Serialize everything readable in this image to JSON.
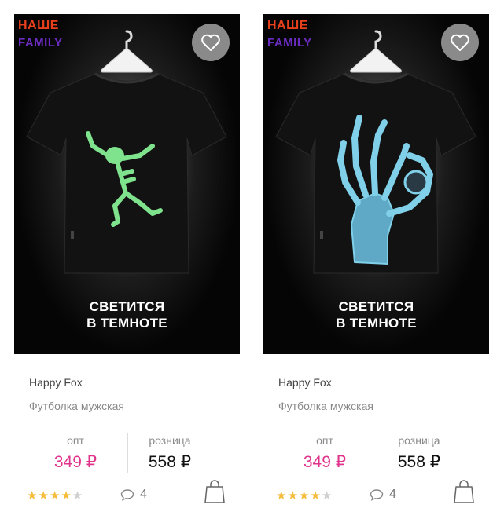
{
  "colors": {
    "tag_top": "#e8401c",
    "tag_bottom": "#6a2cc0",
    "accent_price": "#e0338b",
    "star_on": "#f5bd3b",
    "star_off": "#cfcfcf"
  },
  "products": [
    {
      "tag_line1": "НАШЕ",
      "tag_line2": "FAMILY",
      "caption_line1": "СВЕТИТСЯ",
      "caption_line2": "В ТЕМНОТЕ",
      "brand": "Happy Fox",
      "type": "Футболка мужская",
      "opt_label": "опт",
      "opt_price": "349 ₽",
      "retail_label": "розница",
      "retail_price": "558 ₽",
      "rating": 4,
      "rating_max": 5,
      "reviews": "4",
      "print": "skeleton"
    },
    {
      "tag_line1": "НАШЕ",
      "tag_line2": "FAMILY",
      "caption_line1": "СВЕТИТСЯ",
      "caption_line2": "В ТЕМНОТЕ",
      "brand": "Happy Fox",
      "type": "Футболка мужская",
      "opt_label": "опт",
      "opt_price": "349 ₽",
      "retail_label": "розница",
      "retail_price": "558 ₽",
      "rating": 4,
      "rating_max": 5,
      "reviews": "4",
      "print": "xray-hand"
    }
  ]
}
